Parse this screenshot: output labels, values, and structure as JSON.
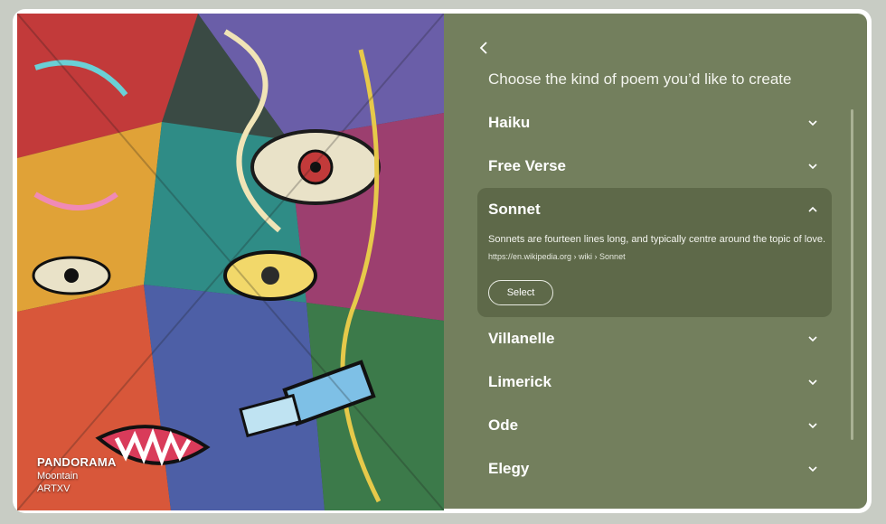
{
  "artwork": {
    "title": "PANDORAMA",
    "subtitle": "Moontain",
    "artist": "ARTXV"
  },
  "panel": {
    "back_icon": "chevron-left-icon",
    "heading": "Choose the kind of poem you’d like to create",
    "items": [
      {
        "label": "Haiku",
        "expanded": false
      },
      {
        "label": "Free Verse",
        "expanded": false
      },
      {
        "label": "Sonnet",
        "expanded": true,
        "description": "Sonnets are fourteen lines long, and typically centre around the topic of love.",
        "link": "https://en.wikipedia.org › wiki › Sonnet",
        "select_label": "Select"
      },
      {
        "label": "Villanelle",
        "expanded": false
      },
      {
        "label": "Limerick",
        "expanded": false
      },
      {
        "label": "Ode",
        "expanded": false
      },
      {
        "label": "Elegy",
        "expanded": false
      }
    ]
  },
  "colors": {
    "panel_bg": "#737f5d",
    "expanded_bg": "#5e6949"
  }
}
